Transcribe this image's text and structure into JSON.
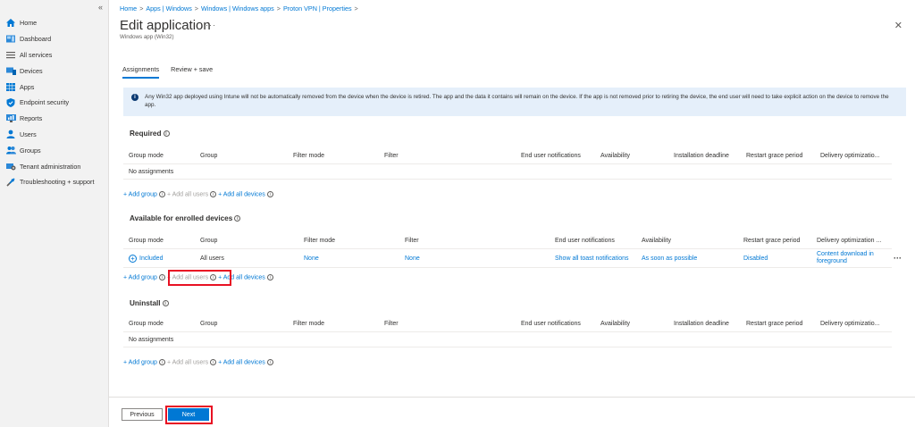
{
  "sidebar": {
    "collapse_glyph": "«",
    "items": [
      {
        "label": "Home",
        "icon": "home-icon"
      },
      {
        "label": "Dashboard",
        "icon": "dashboard-icon"
      },
      {
        "label": "All services",
        "icon": "all-services-icon"
      },
      {
        "label": "Devices",
        "icon": "devices-icon"
      },
      {
        "label": "Apps",
        "icon": "apps-icon"
      },
      {
        "label": "Endpoint security",
        "icon": "endpoint-security-icon"
      },
      {
        "label": "Reports",
        "icon": "reports-icon"
      },
      {
        "label": "Users",
        "icon": "users-icon"
      },
      {
        "label": "Groups",
        "icon": "groups-icon"
      },
      {
        "label": "Tenant administration",
        "icon": "tenant-admin-icon"
      },
      {
        "label": "Troubleshooting + support",
        "icon": "troubleshooting-icon"
      }
    ]
  },
  "breadcrumb": [
    "Home",
    "Apps | Windows",
    "Windows | Windows apps",
    "Proton VPN | Properties"
  ],
  "header": {
    "title": "Edit application",
    "subtitle": "Windows app (Win32)",
    "more": "···",
    "close": "✕"
  },
  "tabs": [
    {
      "label": "Assignments",
      "active": true
    },
    {
      "label": "Review + save",
      "active": false
    }
  ],
  "info": {
    "text": "Any Win32 app deployed using Intune will not be automatically removed from the device when the device is retired. The app and the data it contains will remain on the device. If the app is not removed prior to retiring the device, the end user will need to take explicit action on the device to remove the app."
  },
  "required": {
    "title": "Required",
    "columns": [
      "Group mode",
      "Group",
      "Filter mode",
      "Filter",
      "End user notifications",
      "Availability",
      "Installation deadline",
      "Restart grace period",
      "Delivery optimizatio..."
    ],
    "empty": "No assignments"
  },
  "available": {
    "title": "Available for enrolled devices",
    "columns": [
      "Group mode",
      "Group",
      "Filter mode",
      "Filter",
      "End user notifications",
      "Availability",
      "Restart grace period",
      "Delivery optimization ..."
    ],
    "row": {
      "group_mode": "Included",
      "group": "All users",
      "filter_mode": "None",
      "filter": "None",
      "notifications": "Show all toast notifications",
      "availability": "As soon as possible",
      "restart": "Disabled",
      "delivery_line1": "Content download in",
      "delivery_line2": "foreground",
      "more": "···"
    }
  },
  "uninstall": {
    "title": "Uninstall",
    "columns": [
      "Group mode",
      "Group",
      "Filter mode",
      "Filter",
      "End user notifications",
      "Availability",
      "Installation deadline",
      "Restart grace period",
      "Delivery optimizatio..."
    ],
    "empty": "No assignments"
  },
  "add_links": {
    "add_group": "+ Add group",
    "add_all_users": "+ Add all users",
    "add_all_devices": "+ Add all devices"
  },
  "footer": {
    "previous": "Previous",
    "next": "Next"
  }
}
